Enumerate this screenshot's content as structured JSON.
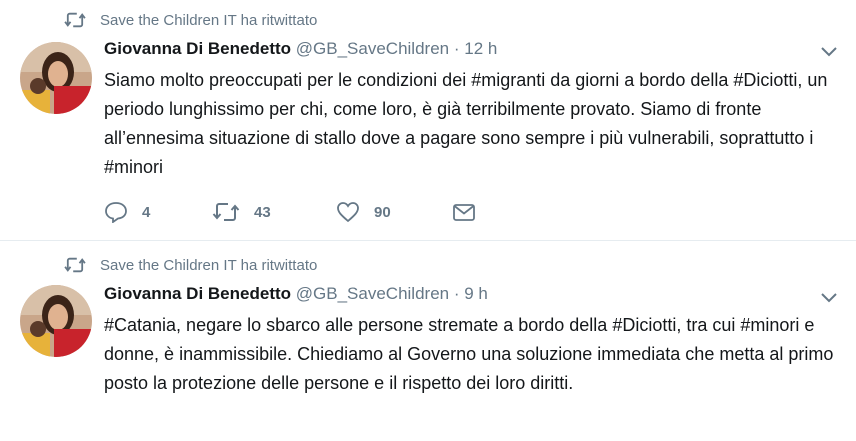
{
  "tweets": [
    {
      "retweeted_by": "Save the Children IT ha ritwittato",
      "author_name": "Giovanna Di Benedetto",
      "handle": "@GB_SaveChildren",
      "separator": "·",
      "time": "12 h",
      "text": "Siamo molto preoccupati per le condizioni dei #migranti da giorni a bordo della #Diciotti, un periodo lunghissimo per chi, come loro, è già terribilmente provato. Siamo di fronte all’ennesima situazione di stallo dove a pagare sono sempre i più vulnerabili, soprattutto i #minori",
      "replies": "4",
      "retweets": "43",
      "likes": "90"
    },
    {
      "retweeted_by": "Save the Children IT ha ritwittato",
      "author_name": "Giovanna Di Benedetto",
      "handle": "@GB_SaveChildren",
      "separator": "·",
      "time": "9 h",
      "text": "#Catania, negare lo sbarco alle persone stremate a bordo della #Diciotti, tra cui #minori e donne, è inammissibile. Chiediamo al Governo una soluzione immediata che metta al primo posto la protezione delle persone e il rispetto dei loro diritti."
    }
  ],
  "icons": {
    "retweet": "retweet-icon",
    "reply": "reply-icon",
    "like": "heart-icon",
    "message": "envelope-icon",
    "more": "chevron-down-icon"
  },
  "colors": {
    "text": "#14171a",
    "secondary": "#657786",
    "divider": "#e6ecf0"
  }
}
